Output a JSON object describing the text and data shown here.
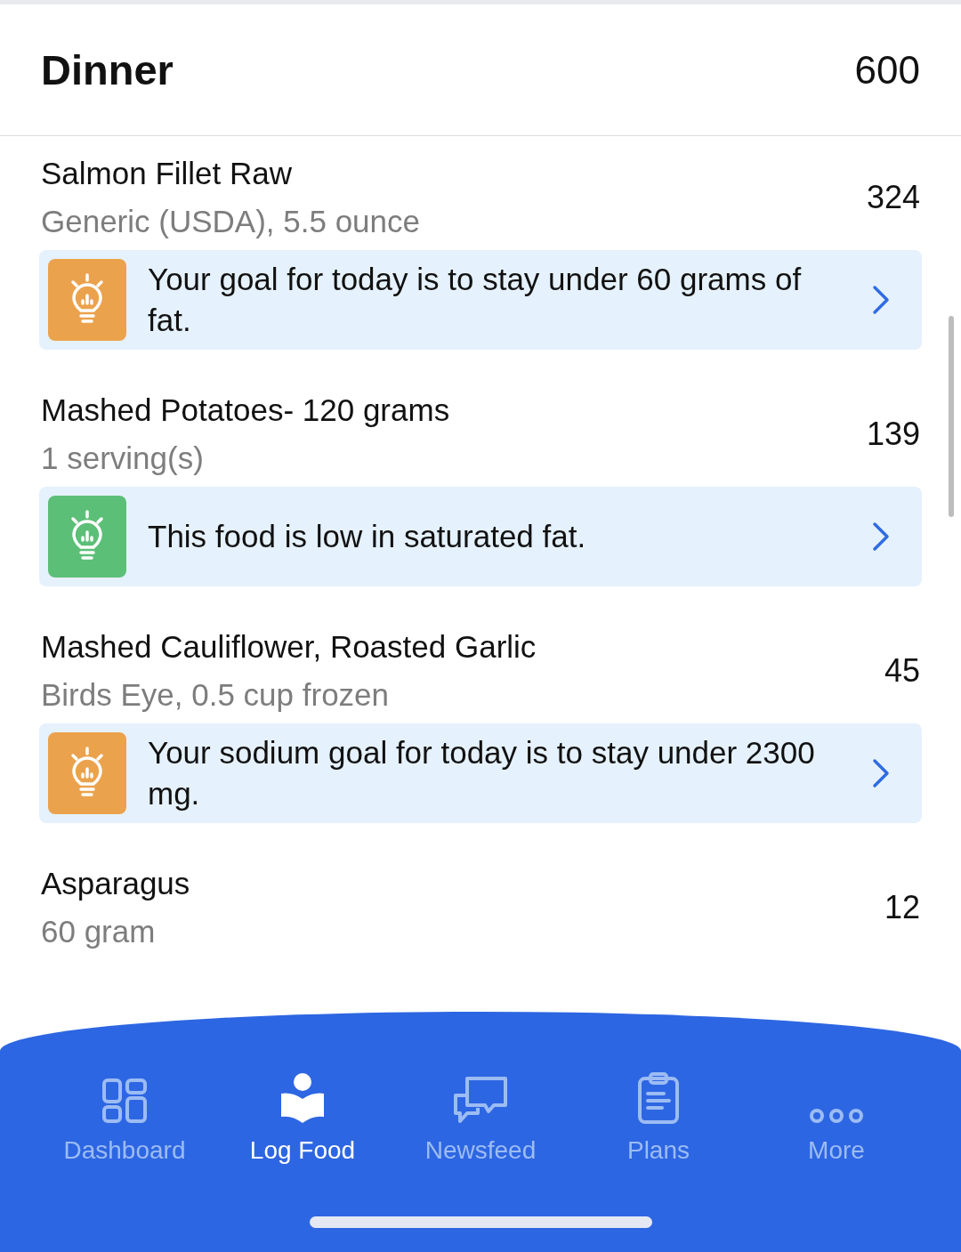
{
  "meal": {
    "title": "Dinner",
    "calories": "600"
  },
  "foods": [
    {
      "name": "Salmon Fillet Raw",
      "detail": "Generic (USDA), 5.5 ounce",
      "calories": "324",
      "tip": {
        "text": "Your goal for today is to stay under 60 grams of fat.",
        "color": "#eba24c"
      }
    },
    {
      "name": "Mashed Potatoes- 120 grams",
      "detail": "1 serving(s)",
      "calories": "139",
      "tip": {
        "text": "This food is low in saturated fat.",
        "color": "#5cbf77"
      }
    },
    {
      "name": "Mashed Cauliflower, Roasted Garlic",
      "detail": "Birds Eye, 0.5 cup frozen",
      "calories": "45",
      "tip": {
        "text": "Your sodium goal for today is to stay under 2300 mg.",
        "color": "#eba24c"
      }
    },
    {
      "name": "Asparagus",
      "detail": "60 gram",
      "calories": "12"
    }
  ],
  "tabs": [
    {
      "label": "Dashboard",
      "kind": "grid",
      "selected": false
    },
    {
      "label": "Log Food",
      "kind": "book",
      "selected": true
    },
    {
      "label": "Newsfeed",
      "kind": "chat",
      "selected": false
    },
    {
      "label": "Plans",
      "kind": "clipboard",
      "selected": false
    },
    {
      "label": "More",
      "kind": "dots",
      "selected": false
    }
  ]
}
